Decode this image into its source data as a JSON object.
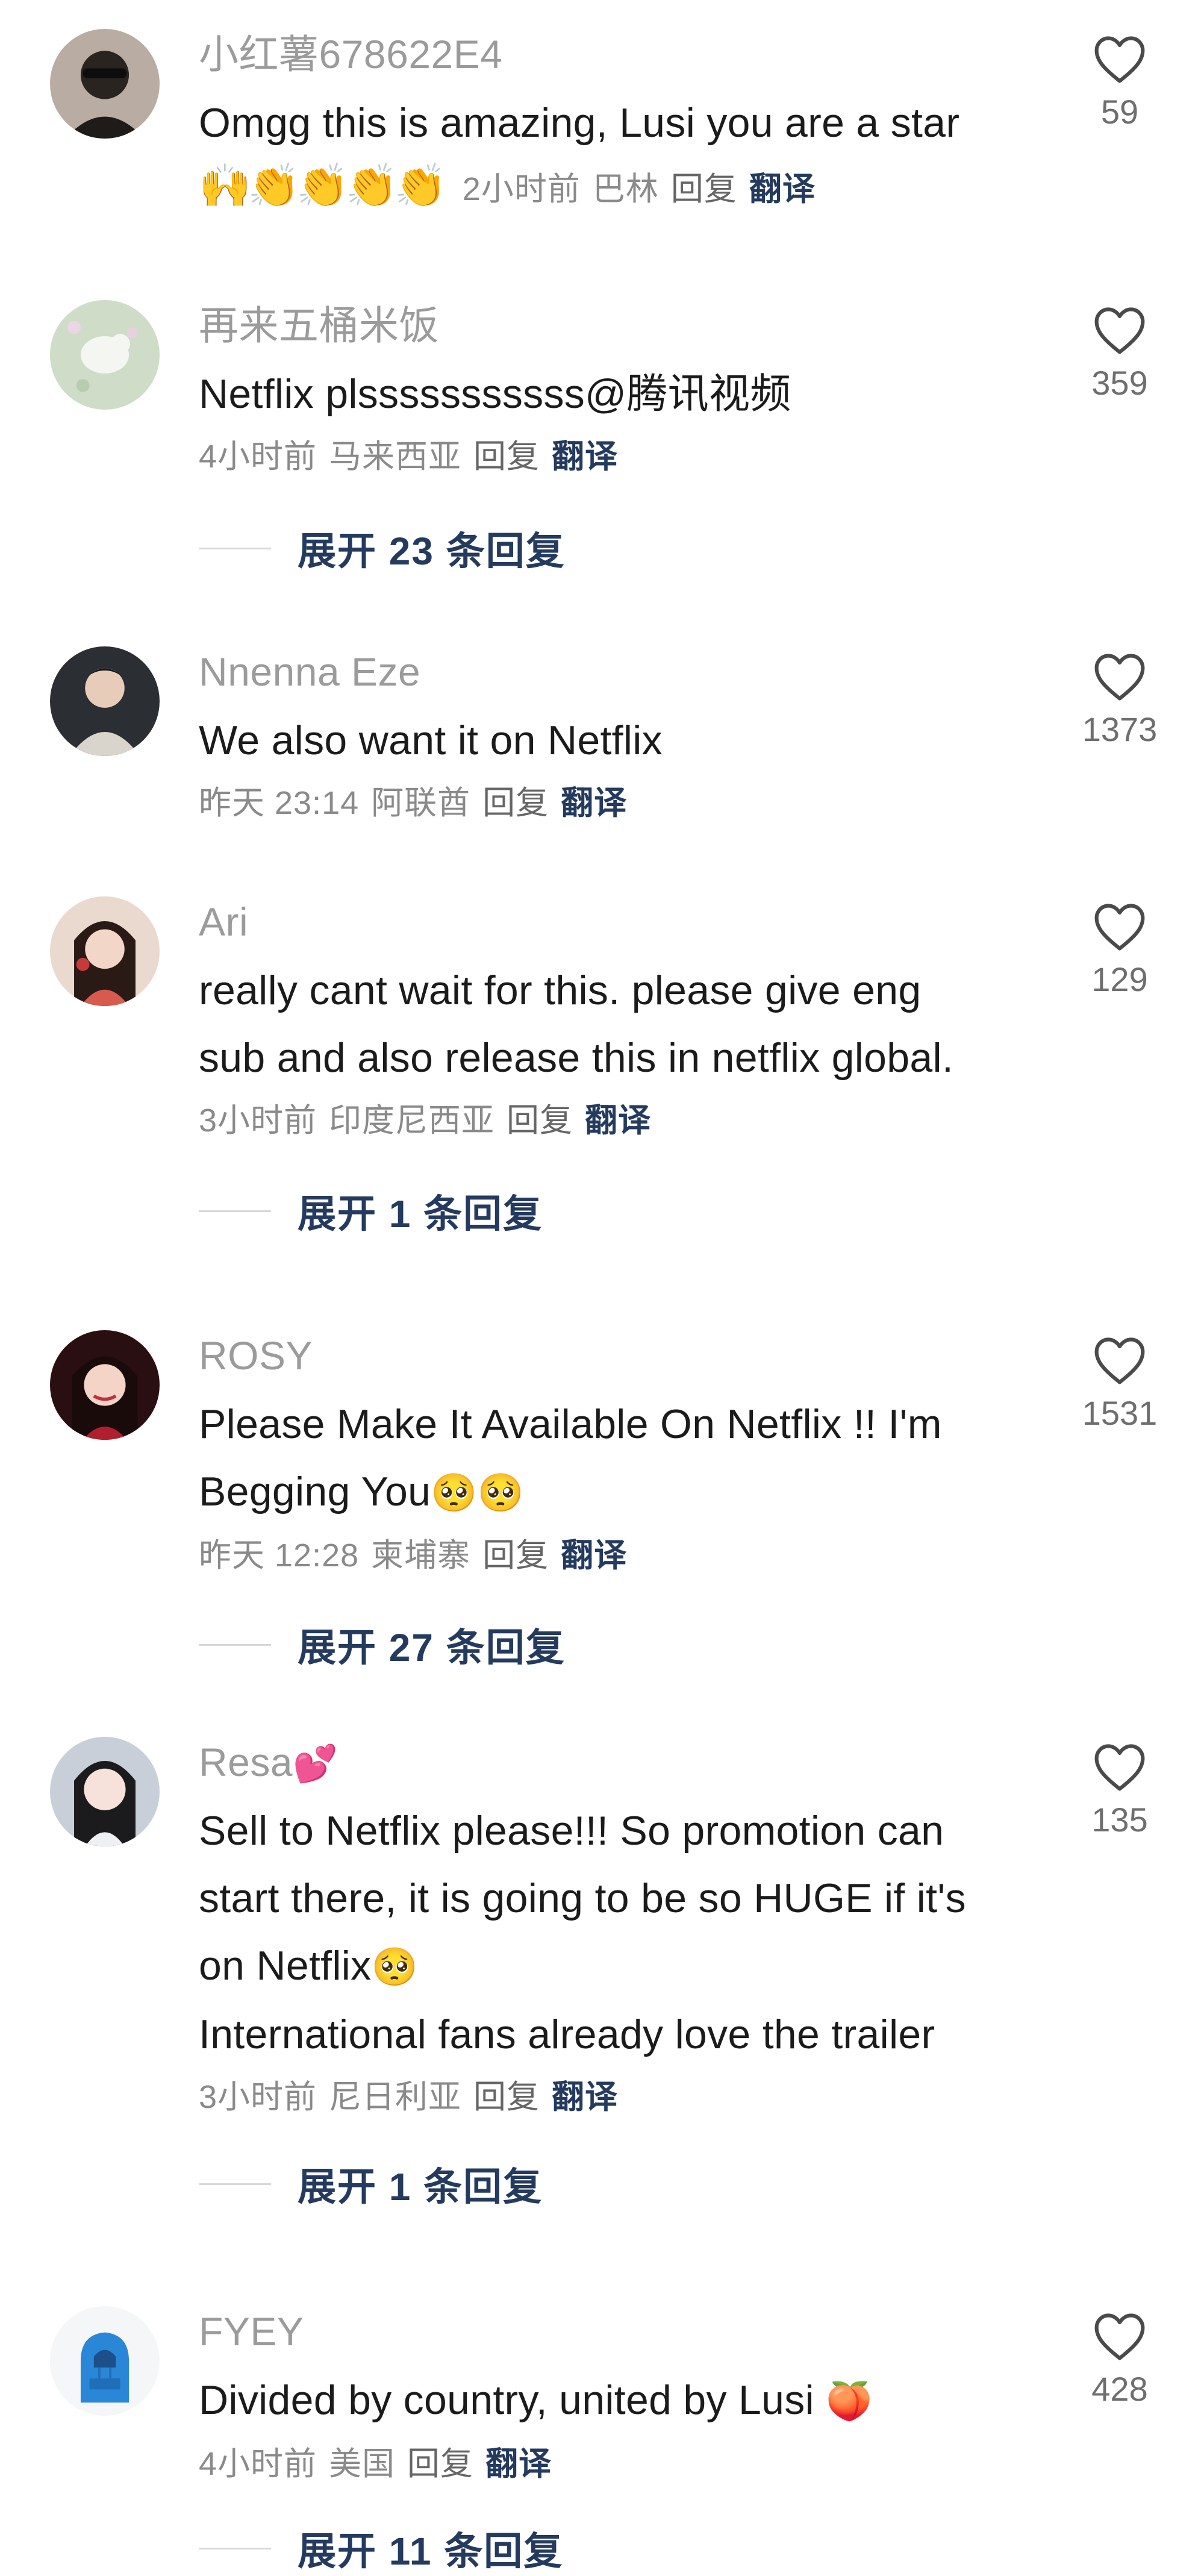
{
  "comments": [
    {
      "username": "小红薯678622E4",
      "text_lines": [
        "Omgg this is amazing, Lusi you are a star"
      ],
      "emoji_prefix": "🙌👏👏👏👏",
      "time": "2小时前",
      "location": "巴林",
      "reply": "回复",
      "translate": "翻译",
      "likes": "59"
    },
    {
      "username": "再来五桶米饭",
      "text_lines": [
        "Netflix plsssssssssss@腾讯视频"
      ],
      "time": "4小时前",
      "location": "马来西亚",
      "reply": "回复",
      "translate": "翻译",
      "likes": "359",
      "expand": "展开 23 条回复"
    },
    {
      "username": "Nnenna Eze",
      "text_lines": [
        "We also want it on Netflix"
      ],
      "time": "昨天 23:14",
      "location": "阿联酋",
      "reply": "回复",
      "translate": "翻译",
      "likes": "1373"
    },
    {
      "username": "Ari",
      "text_lines": [
        "really cant wait for this. please give eng",
        "sub and also release this in netflix global."
      ],
      "time": "3小时前",
      "location": "印度尼西亚",
      "reply": "回复",
      "translate": "翻译",
      "likes": "129",
      "expand": "展开 1 条回复"
    },
    {
      "username": "ROSY",
      "text_lines": [
        "Please Make It Available On Netflix !! I'm",
        "Begging You"
      ],
      "text_emoji": "🥺🥺",
      "time": "昨天 12:28",
      "location": "柬埔寨",
      "reply": "回复",
      "translate": "翻译",
      "likes": "1531",
      "expand": "展开 27 条回复"
    },
    {
      "username": "Resa",
      "username_emoji": "💕",
      "text_lines": [
        "Sell to Netflix please!!! So promotion can",
        "start there, it is going to be so HUGE if it's",
        "on Netflix",
        "International fans already love the trailer"
      ],
      "text_emoji": "🥺",
      "time": "3小时前",
      "location": "尼日利亚",
      "reply": "回复",
      "translate": "翻译",
      "likes": "135",
      "expand": "展开 1 条回复"
    },
    {
      "username": "FYEY",
      "text_lines": [
        "Divided by country, united by Lusi"
      ],
      "text_emoji": "🍑",
      "time": "4小时前",
      "location": "美国",
      "reply": "回复",
      "translate": "翻译",
      "likes": "428",
      "expand": "展开 11 条回复"
    }
  ],
  "icons": {
    "like": "heart-outline-icon"
  },
  "colors": {
    "username": "#9b9b9b",
    "translate": "#243a5e",
    "expand": "#243a5e"
  }
}
